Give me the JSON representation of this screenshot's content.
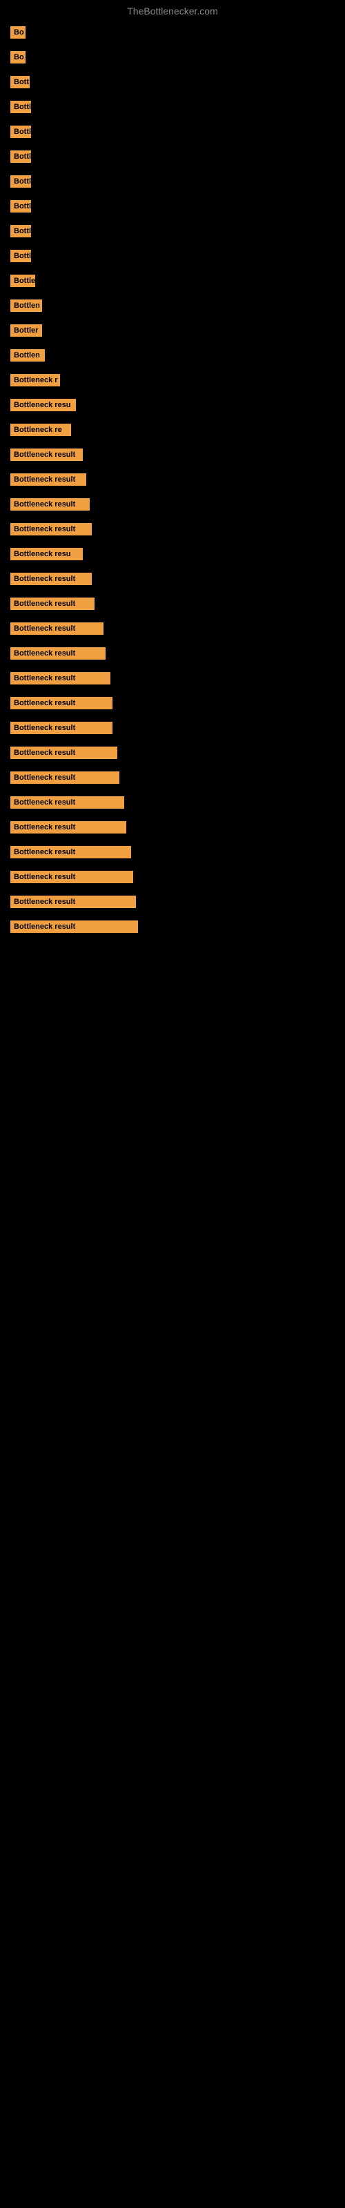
{
  "site": {
    "title": "TheBottlenecker.com"
  },
  "rows": [
    {
      "id": 1,
      "label": "Bo",
      "width": 22
    },
    {
      "id": 2,
      "label": "Bo",
      "width": 22
    },
    {
      "id": 3,
      "label": "Bott",
      "width": 28
    },
    {
      "id": 4,
      "label": "Bottl",
      "width": 30
    },
    {
      "id": 5,
      "label": "Bottl",
      "width": 30
    },
    {
      "id": 6,
      "label": "Bottl",
      "width": 30
    },
    {
      "id": 7,
      "label": "Bottl",
      "width": 30
    },
    {
      "id": 8,
      "label": "Bottl",
      "width": 30
    },
    {
      "id": 9,
      "label": "Bottl",
      "width": 30
    },
    {
      "id": 10,
      "label": "Bottl",
      "width": 30
    },
    {
      "id": 11,
      "label": "Bottle",
      "width": 36
    },
    {
      "id": 12,
      "label": "Bottlen",
      "width": 46
    },
    {
      "id": 13,
      "label": "Bottler",
      "width": 46
    },
    {
      "id": 14,
      "label": "Bottlen",
      "width": 50
    },
    {
      "id": 15,
      "label": "Bottleneck r",
      "width": 72
    },
    {
      "id": 16,
      "label": "Bottleneck resu",
      "width": 95
    },
    {
      "id": 17,
      "label": "Bottleneck re",
      "width": 88
    },
    {
      "id": 18,
      "label": "Bottleneck result",
      "width": 105
    },
    {
      "id": 19,
      "label": "Bottleneck result",
      "width": 110
    },
    {
      "id": 20,
      "label": "Bottleneck result",
      "width": 115
    },
    {
      "id": 21,
      "label": "Bottleneck result",
      "width": 118
    },
    {
      "id": 22,
      "label": "Bottleneck resu",
      "width": 105
    },
    {
      "id": 23,
      "label": "Bottleneck result",
      "width": 118
    },
    {
      "id": 24,
      "label": "Bottleneck result",
      "width": 122
    },
    {
      "id": 25,
      "label": "Bottleneck result",
      "width": 135
    },
    {
      "id": 26,
      "label": "Bottleneck result",
      "width": 138
    },
    {
      "id": 27,
      "label": "Bottleneck result",
      "width": 145
    },
    {
      "id": 28,
      "label": "Bottleneck result",
      "width": 148
    },
    {
      "id": 29,
      "label": "Bottleneck result",
      "width": 148
    },
    {
      "id": 30,
      "label": "Bottleneck result",
      "width": 155
    },
    {
      "id": 31,
      "label": "Bottleneck result",
      "width": 158
    },
    {
      "id": 32,
      "label": "Bottleneck result",
      "width": 165
    },
    {
      "id": 33,
      "label": "Bottleneck result",
      "width": 168
    },
    {
      "id": 34,
      "label": "Bottleneck result",
      "width": 175
    },
    {
      "id": 35,
      "label": "Bottleneck result",
      "width": 178
    },
    {
      "id": 36,
      "label": "Bottleneck result",
      "width": 182
    },
    {
      "id": 37,
      "label": "Bottleneck result",
      "width": 185
    }
  ]
}
